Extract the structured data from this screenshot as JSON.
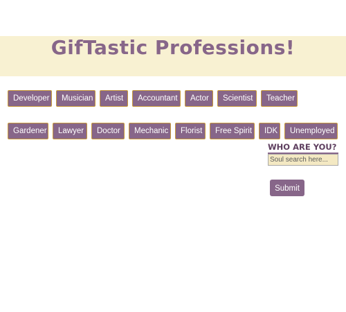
{
  "header": {
    "title": "GifTastic Professions!"
  },
  "professions": {
    "row1": [
      "Developer",
      "Musician",
      "Artist",
      "Accountant",
      "Actor",
      "Scientist",
      "Teacher"
    ],
    "row2": [
      "Gardener",
      "Lawyer",
      "Doctor",
      "Mechanic",
      "Florist",
      "Free Spirit",
      "IDK",
      "Unemployed"
    ]
  },
  "form": {
    "heading": "WHO ARE YOU?",
    "placeholder": "Soul search here...",
    "value": "",
    "submit_label": "Submit"
  },
  "colors": {
    "banner": "#f8f1d2",
    "accent": "#876689",
    "button_border": "#c99a3a",
    "input_bg": "#f4e9c3"
  }
}
